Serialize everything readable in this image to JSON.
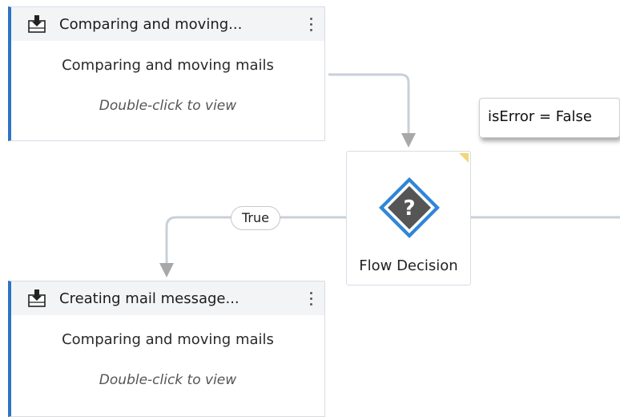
{
  "activities": [
    {
      "title": "Comparing and moving...",
      "subtitle": "Comparing and moving mails",
      "hint": "Double-click to view"
    },
    {
      "title": "Creating mail message...",
      "subtitle": "Comparing and moving mails",
      "hint": "Double-click to view"
    }
  ],
  "decision": {
    "label": "Flow Decision",
    "symbol": "?"
  },
  "connector_labels": {
    "true": "True",
    "false_condition": "isError = False"
  },
  "colors": {
    "accent": "#2d74c4",
    "connector": "#c8d0da",
    "arrow": "#a8a8a8",
    "diamond_outer": "#2f86d6",
    "diamond_inner": "#555555"
  },
  "icons": {
    "activity_icon": "sequence-activity-icon",
    "menu_icon": "more-vertical-icon",
    "decision_icon": "flow-decision-icon"
  }
}
